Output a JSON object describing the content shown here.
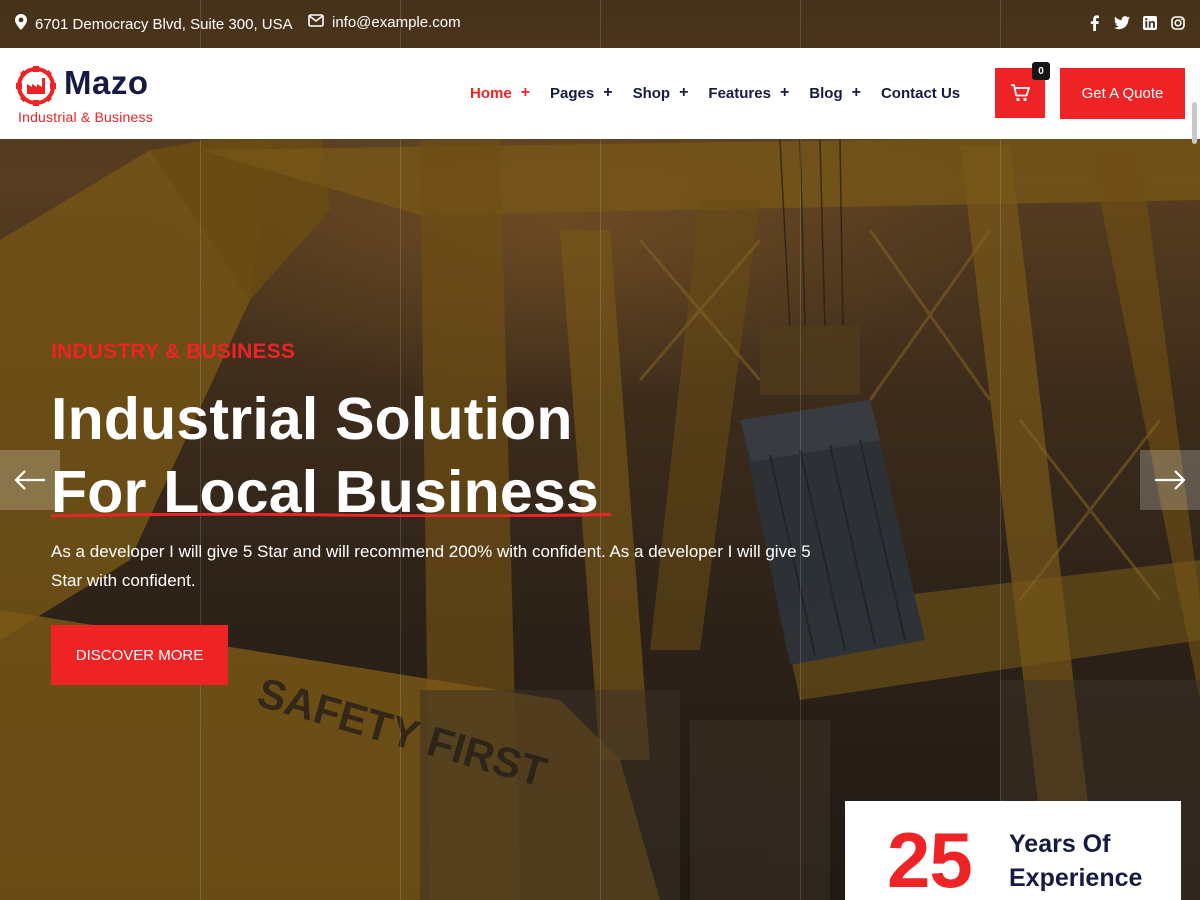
{
  "topbar": {
    "address": "6701 Democracy Blvd, Suite 300, USA",
    "email": "info@example.com",
    "social": [
      "facebook-icon",
      "twitter-icon",
      "linkedin-icon",
      "instagram-icon"
    ]
  },
  "header": {
    "logo_title": "Mazo",
    "logo_subtitle": "Industrial & Business",
    "nav": [
      {
        "label": "Home",
        "has_submenu": true,
        "active": true
      },
      {
        "label": "Pages",
        "has_submenu": true
      },
      {
        "label": "Shop",
        "has_submenu": true
      },
      {
        "label": "Features",
        "has_submenu": true
      },
      {
        "label": "Blog",
        "has_submenu": true
      },
      {
        "label": "Contact Us",
        "has_submenu": false
      }
    ],
    "submenu_marker": "+",
    "cart_count": "0",
    "quote_label": "Get A Quote"
  },
  "hero": {
    "eyebrow": "INDUSTRY & BUSINESS",
    "headline_line1": "Industrial Solution",
    "headline_line2": "For Local Business",
    "description": "As a developer I will give 5 Star and will recommend 200% with confident. As a developer I will give 5 Star with confident.",
    "cta_label": "DISCOVER MORE",
    "background_watermark": "SAFETY FIRST"
  },
  "experience": {
    "number": "25",
    "label": "Years Of Experience"
  },
  "colors": {
    "accent": "#ee2326",
    "navy": "#161b42",
    "white": "#ffffff"
  }
}
